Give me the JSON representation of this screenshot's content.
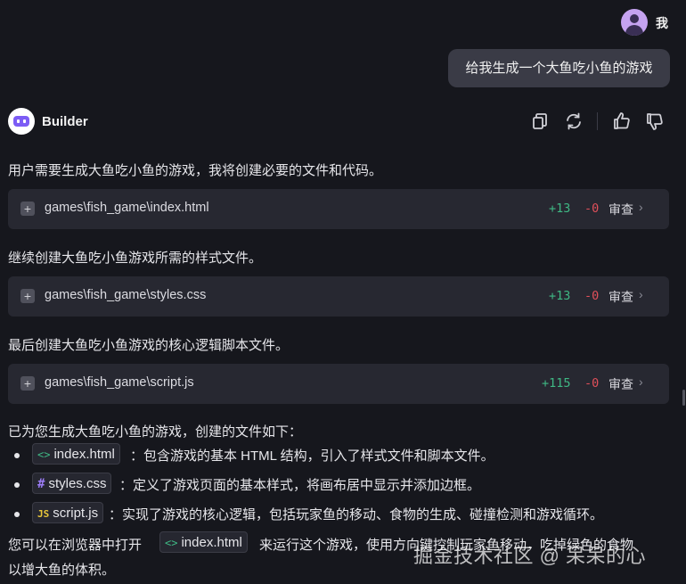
{
  "user": {
    "name": "我",
    "message": "给我生成一个大鱼吃小鱼的游戏"
  },
  "bot": {
    "name": "Builder"
  },
  "toolbar_icons": [
    "copy-icon",
    "refresh-icon",
    "thumbs-up-icon",
    "thumbs-down-icon"
  ],
  "messages": {
    "intro": "用户需要生成大鱼吃小鱼的游戏，我将创建必要的文件和代码。",
    "continue": "继续创建大鱼吃小鱼游戏所需的样式文件。",
    "final": "最后创建大鱼吃小鱼游戏的核心逻辑脚本文件。",
    "summary": "已为您生成大鱼吃小鱼的游戏，创建的文件如下：",
    "closing_1a": "您可以在浏览器中打开",
    "closing_1b": "来运行这个游戏，使用方向键控制玩家鱼移动，吃掉绿色的食物",
    "closing_2": "以增大鱼的体积。"
  },
  "files": [
    {
      "path": "games\\fish_game\\index.html",
      "added": "+13",
      "removed": "-0",
      "action": "审查"
    },
    {
      "path": "games\\fish_game\\styles.css",
      "added": "+13",
      "removed": "-0",
      "action": "审查"
    },
    {
      "path": "games\\fish_game\\script.js",
      "added": "+115",
      "removed": "-0",
      "action": "审查"
    }
  ],
  "file_list": [
    {
      "icon": "<>",
      "name": "index.html",
      "desc": "：包含游戏的基本 HTML 结构，引入了样式文件和脚本文件。"
    },
    {
      "icon": "#",
      "name": "styles.css",
      "desc": "：定义了游戏页面的基本样式，将画布居中显示并添加边框。"
    },
    {
      "icon": "JS",
      "name": "script.js",
      "desc": "：实现了游戏的核心逻辑，包括玩家鱼的移动、食物的生成、碰撞检测和游戏循环。"
    }
  ],
  "inline_chip": {
    "icon": "<>",
    "name": "index.html"
  },
  "watermark": "掘金技术社区 @ 呆呆的心",
  "colors": {
    "background": "#16171d",
    "card": "#272831",
    "added": "#3fb884",
    "removed": "#e0505a",
    "accent": "#7c5cf5"
  }
}
